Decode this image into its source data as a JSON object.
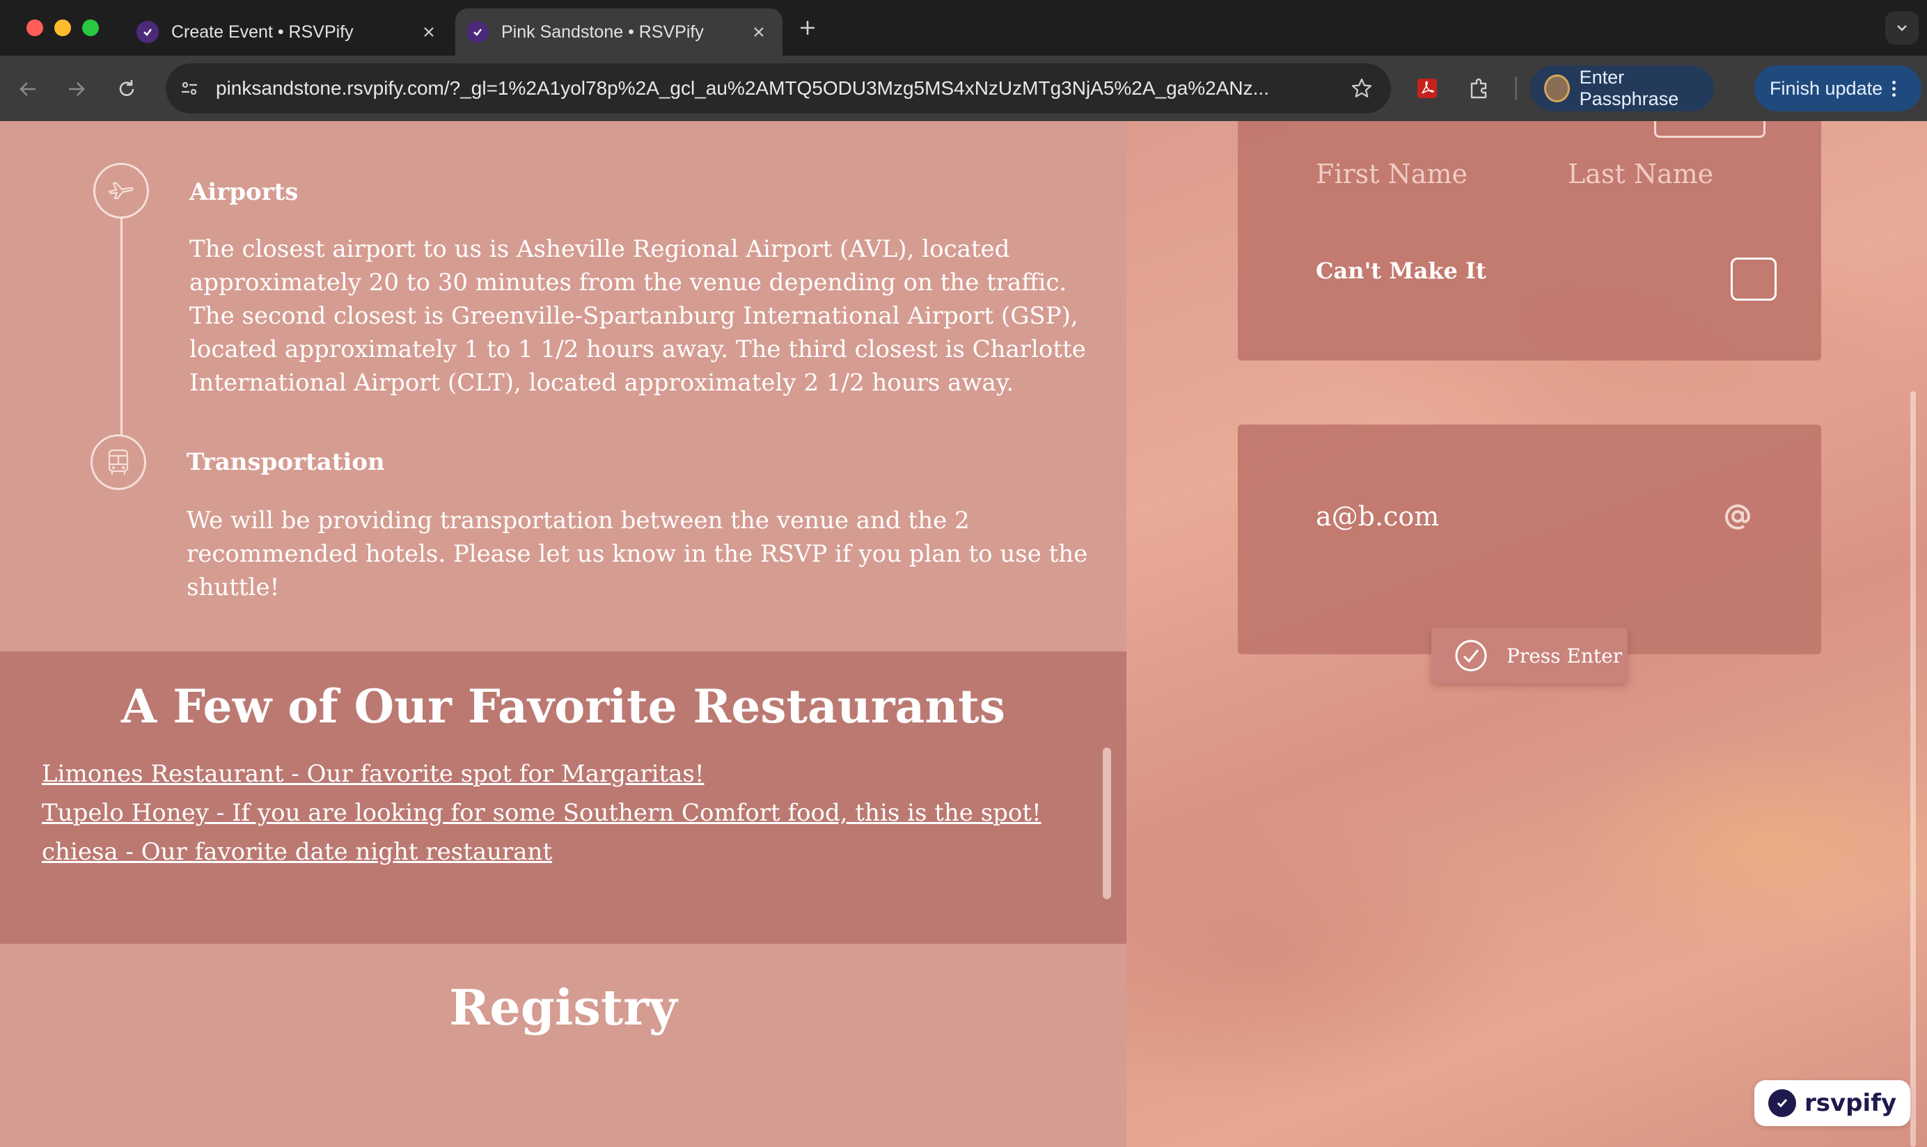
{
  "browser": {
    "tabs": [
      {
        "title": "Create Event • RSVPify",
        "active": false
      },
      {
        "title": "Pink Sandstone • RSVPify",
        "active": true
      }
    ],
    "url": "pinksandstone.rsvpify.com/?_gl=1%2A1yol78p%2A_gcl_au%2AMTQ5ODU3Mzg5MS4xNzUzMTg3NjA5%2A_ga%2ANz...",
    "passphrase_label": "Enter Passphrase",
    "update_label": "Finish update"
  },
  "travel": {
    "items": [
      {
        "icon": "airplane-icon",
        "title": "Airports",
        "body": "The closest airport to us is Asheville Regional Airport (AVL), located approximately 20 to 30 minutes from the venue depending on the traffic. The second closest is Greenville-Spartanburg International Airport (GSP), located approximately 1 to 1 1/2 hours away. The third closest is Charlotte International Airport (CLT), located approximately 2 1/2 hours away."
      },
      {
        "icon": "bus-icon",
        "title": "Transportation",
        "body": "We will be providing transportation between the venue and the 2 recommended hotels. Please let us know in the RSVP if you plan to use the shuttle!"
      }
    ]
  },
  "restaurants": {
    "title": "A Few of Our Favorite Restaurants",
    "links": [
      "Limones Restaurant - Our favorite spot for Margaritas!",
      "Tupelo Honey - If you are looking for some Southern Comfort food, this is the spot!",
      "chiesa - Our favorite date night restaurant"
    ]
  },
  "registry": {
    "title": "Registry"
  },
  "rsvp_form": {
    "first_name_placeholder": "First Name",
    "last_name_placeholder": "Last Name",
    "cant_make_it_label": "Can't Make It",
    "cant_make_it_checked": false,
    "email_value": "a@b.com",
    "press_enter_label": "Press Enter"
  },
  "badge": {
    "text": "rsvpify"
  },
  "colors": {
    "page_bg": "#d59c92",
    "restaurants_bg": "#bb7972",
    "card_bg": "#c0766c",
    "accent_dark": "#1f1a4d"
  }
}
